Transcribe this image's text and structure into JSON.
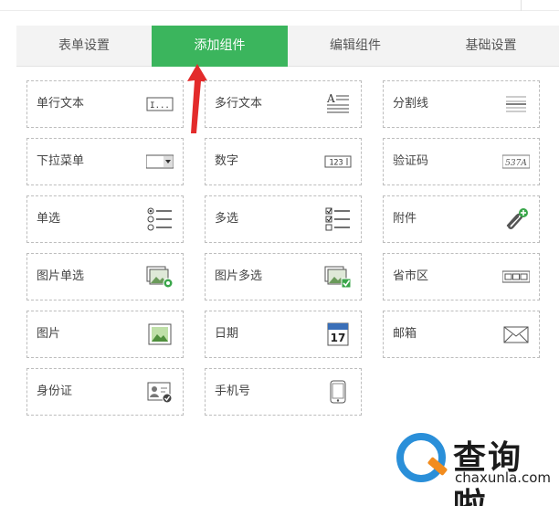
{
  "tabs": [
    {
      "label": "表单设置"
    },
    {
      "label": "添加组件"
    },
    {
      "label": "编辑组件"
    },
    {
      "label": "基础设置"
    }
  ],
  "components": [
    {
      "label": "单行文本",
      "icon": "single-line-text-icon",
      "icon_text": "I..."
    },
    {
      "label": "多行文本",
      "icon": "multi-line-text-icon",
      "icon_text": "A"
    },
    {
      "label": "分割线",
      "icon": "divider-icon"
    },
    {
      "label": "下拉菜单",
      "icon": "dropdown-icon"
    },
    {
      "label": "数字",
      "icon": "number-icon",
      "icon_text": "123"
    },
    {
      "label": "验证码",
      "icon": "captcha-icon",
      "icon_text": "537A"
    },
    {
      "label": "单选",
      "icon": "radio-icon"
    },
    {
      "label": "多选",
      "icon": "checkbox-icon"
    },
    {
      "label": "附件",
      "icon": "attachment-icon"
    },
    {
      "label": "图片单选",
      "icon": "image-radio-icon"
    },
    {
      "label": "图片多选",
      "icon": "image-checkbox-icon"
    },
    {
      "label": "省市区",
      "icon": "region-icon"
    },
    {
      "label": "图片",
      "icon": "image-icon"
    },
    {
      "label": "日期",
      "icon": "calendar-icon",
      "icon_text": "17"
    },
    {
      "label": "邮箱",
      "icon": "email-icon"
    },
    {
      "label": "身份证",
      "icon": "id-card-icon"
    },
    {
      "label": "手机号",
      "icon": "phone-icon"
    }
  ],
  "watermark": {
    "brand": "查询啦",
    "url": "chaxunla.com"
  },
  "colors": {
    "accent": "#3bb55d",
    "arrow": "#e32b2b"
  }
}
